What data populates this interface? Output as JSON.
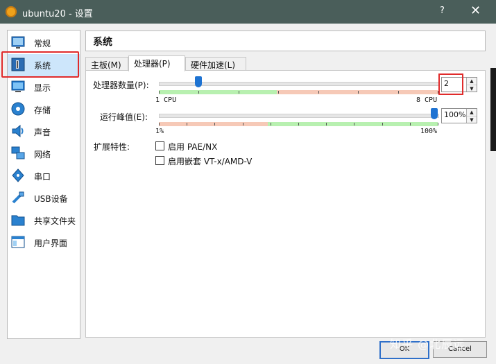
{
  "window": {
    "title": "ubuntu20 - 设置",
    "help": "?",
    "close": "✕"
  },
  "sidebar": {
    "items": [
      {
        "label": "常规",
        "icon": "general-icon"
      },
      {
        "label": "系统",
        "icon": "motherboard-icon"
      },
      {
        "label": "显示",
        "icon": "monitor-icon"
      },
      {
        "label": "存储",
        "icon": "disk-icon"
      },
      {
        "label": "声音",
        "icon": "speaker-icon"
      },
      {
        "label": "网络",
        "icon": "network-icon"
      },
      {
        "label": "串口",
        "icon": "serial-port-icon"
      },
      {
        "label": "USB设备",
        "icon": "usb-icon"
      },
      {
        "label": "共享文件夹",
        "icon": "folder-icon"
      },
      {
        "label": "用户界面",
        "icon": "window-icon"
      }
    ],
    "selected": 1
  },
  "panel": {
    "title": "系统"
  },
  "tabs": [
    {
      "label": "主板(M)"
    },
    {
      "label": "处理器(P)"
    },
    {
      "label": "硬件加速(L)"
    }
  ],
  "processor": {
    "cpu_label": "处理器数量(P):",
    "cpu_value": "2",
    "cpu_min": "1 CPU",
    "cpu_max": "8 CPU",
    "cpu_fraction": 0.143,
    "cap_label": "运行峰值(E):",
    "cap_value": "100%",
    "cap_min": "1%",
    "cap_max": "100%",
    "cap_fraction": 1.0,
    "ext_label": "扩展特性:",
    "pae_label": "启用 PAE/NX",
    "vtx_label": "启用嵌套 VT-x/AMD-V"
  },
  "buttons": {
    "ok": "OK",
    "cancel": "Cancel"
  },
  "watermark": "知乎 @北辰远",
  "colors": {
    "accent": "#1e73d2",
    "highlight": "#e02b2b",
    "green": "#b8f0b0",
    "red": "#f6c9b7"
  }
}
